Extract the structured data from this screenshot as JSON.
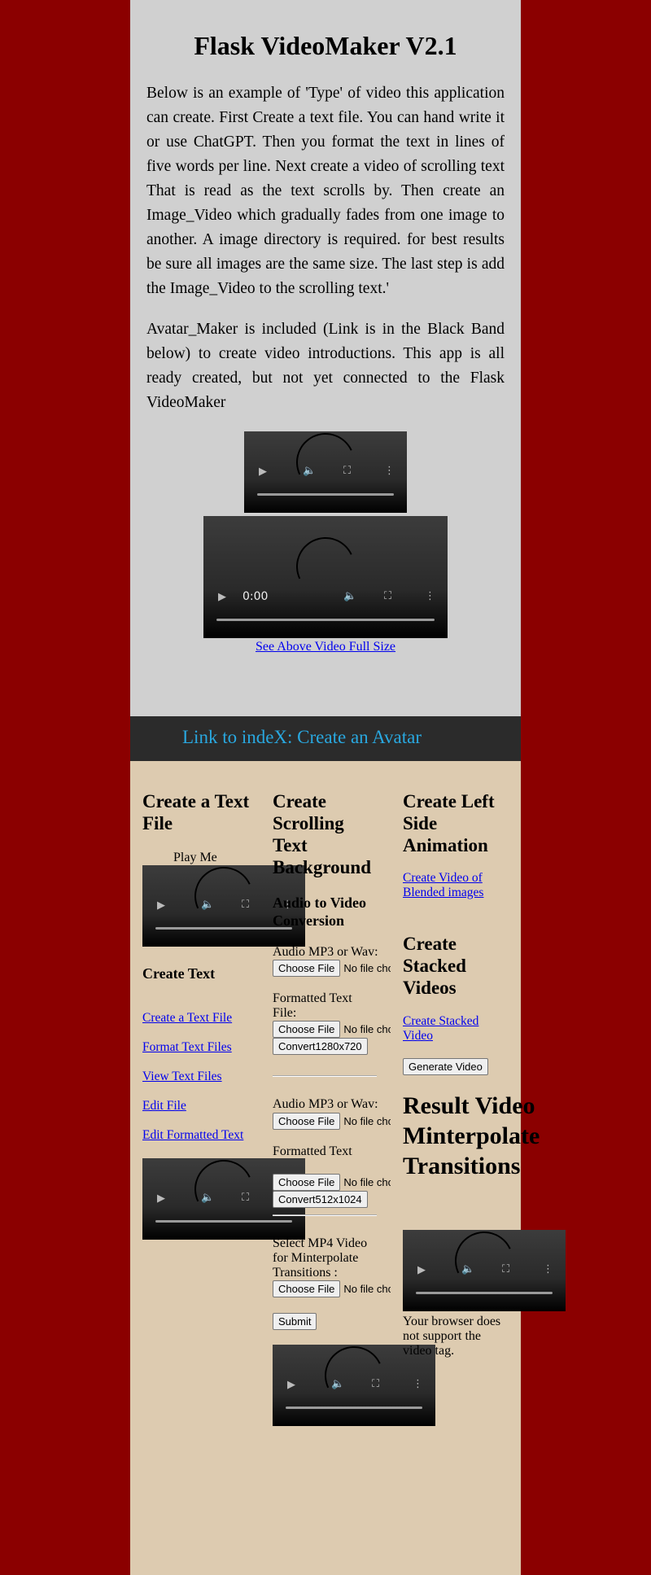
{
  "header": {
    "title": "Flask VideoMaker V2.1"
  },
  "intro": {
    "p1": "Below is an example of 'Type' of video this application can create. First Create a text file. You can hand write it or use ChatGPT. Then you format the text in lines of five words per line. Next create a video of scrolling text That is read as the text scrolls by. Then create an Image_Video which gradually fades from one image to another. A image directory is required. for best results be sure all images are the same size. The last step is add the Image_Video to the scrolling text.'",
    "p2": "Avatar_Maker is included (Link is in the Black Band below) to create video introductions. This app is all ready created, but not yet connected to the Flask VideoMaker"
  },
  "top_videos": {
    "second_time": "0:00",
    "full_size_link": "See Above Video Full Size"
  },
  "band": {
    "link": "Link to indeX: Create an Avatar"
  },
  "col1": {
    "heading": "Create a Text File",
    "play_me": "Play Me",
    "subheading": "Create Text",
    "links": [
      "Create a Text File",
      "Format Text Files",
      "View Text Files",
      "Edit File",
      "Edit Formatted Text"
    ]
  },
  "col2": {
    "heading": "Create Scrolling Text Background",
    "subheading": "Audio to Video Conversion",
    "form1": {
      "audio_label": "Audio MP3 or Wav:",
      "text_label": "Formatted Text File:",
      "button": "Convert1280x720"
    },
    "form2": {
      "audio_label": "Audio MP3 or Wav:",
      "text_label": "Formatted Text",
      "button": "Convert512x1024"
    },
    "form3": {
      "label": "Select MP4 Video for Minterpolate Transitions :",
      "submit": "Submit"
    },
    "file_button": "Choose File",
    "file_none": "No file chosen"
  },
  "col3": {
    "heading1": "Create Left Side Animation",
    "link1": "Create Video of Blended images",
    "heading2": "Create Stacked Videos",
    "link2": "Create Stacked Video",
    "generate_button": "Generate Video",
    "heading3": "Result Video Minterpolate Transitions",
    "fallback": "Your browser does not support the video tag."
  },
  "colors": {
    "side": "#8b0000",
    "top_bg": "#d0d0d0",
    "band": "#2b2b2b",
    "band_link": "#29a8e0",
    "bottom_bg": "#ddcbb0",
    "link": "#0000ee"
  },
  "icons": [
    "play-icon",
    "volume-icon",
    "fullscreen-icon",
    "more-options-icon"
  ]
}
